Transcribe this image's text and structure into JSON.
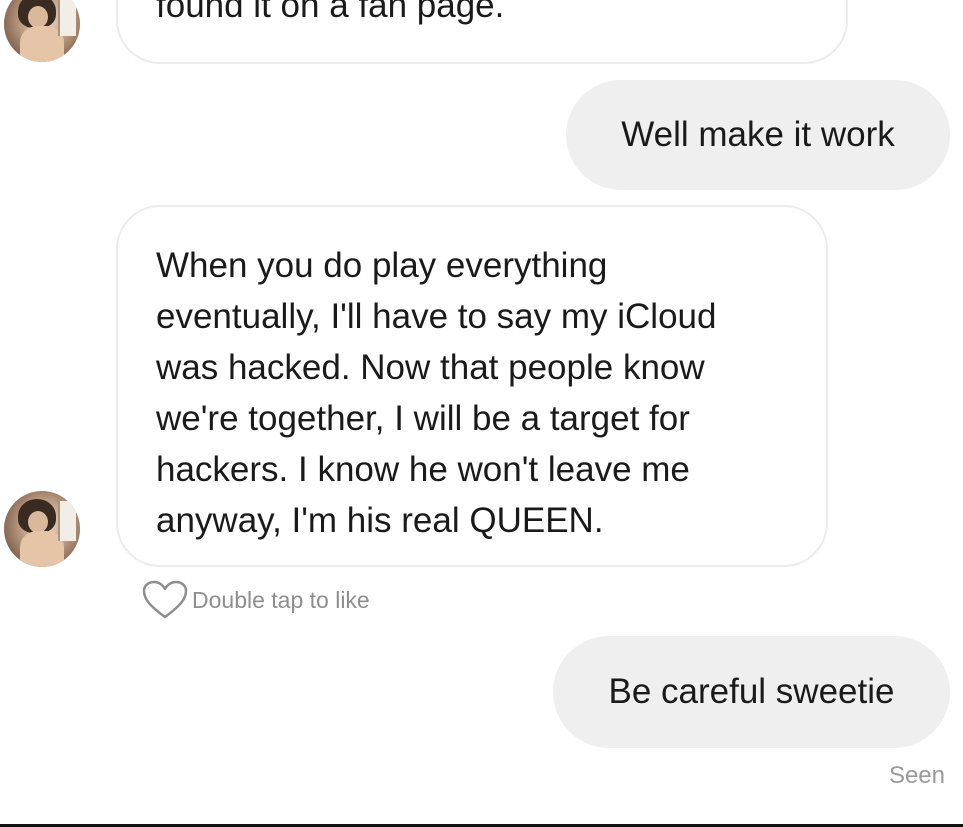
{
  "messages": [
    {
      "direction": "incoming",
      "text": "found it on a fan page."
    },
    {
      "direction": "outgoing",
      "text": "Well make it work"
    },
    {
      "direction": "incoming",
      "lines": [
        "When you do play everything",
        "eventually, I'll have to say my iCloud",
        "was hacked. Now that people know",
        "we're together, I will be a target for",
        "hackers. I know he won't leave me",
        "anyway, I'm his real QUEEN."
      ]
    },
    {
      "direction": "outgoing",
      "text": "Be careful sweetie"
    }
  ],
  "like_hint": {
    "text": "Double tap to like",
    "icon": "heart-outline-icon"
  },
  "status": {
    "seen": "Seen"
  },
  "colors": {
    "outgoing_bubble": "#efefef",
    "incoming_border": "#ececec",
    "meta_text": "#8e8e8e"
  }
}
